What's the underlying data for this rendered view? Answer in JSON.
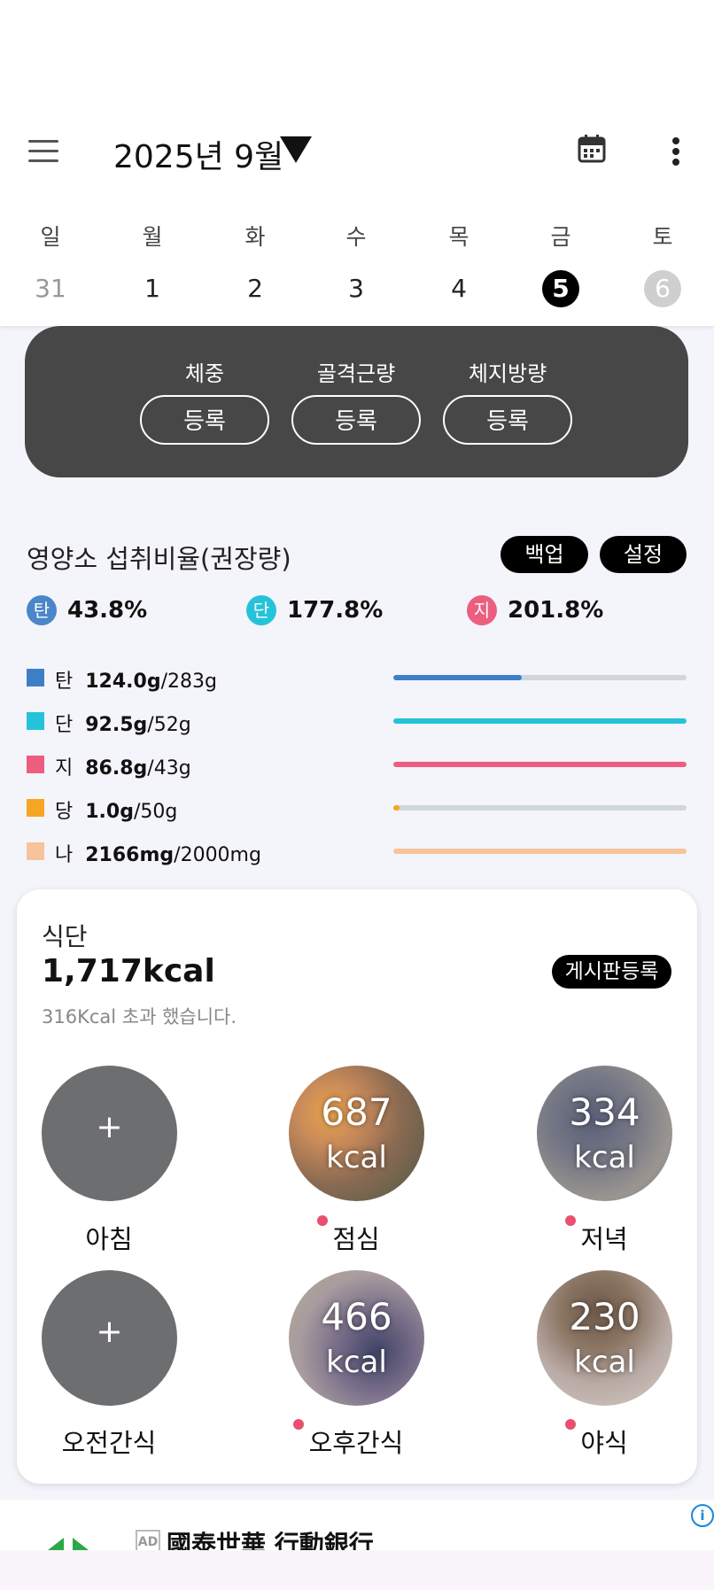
{
  "header": {
    "month_label": "2025년 9월",
    "icons": [
      "menu-icon",
      "dropdown-arrow-icon",
      "calendar-icon",
      "more-vert-icon"
    ]
  },
  "week": {
    "days": [
      "일",
      "월",
      "화",
      "수",
      "목",
      "금",
      "토"
    ],
    "dates": [
      "31",
      "1",
      "2",
      "3",
      "4",
      "5",
      "6"
    ],
    "selected_date": "5",
    "today_date": "6"
  },
  "body_card": {
    "items": [
      {
        "label": "체중",
        "button": "등록"
      },
      {
        "label": "골격근량",
        "button": "등록"
      },
      {
        "label": "체지방량",
        "button": "등록"
      }
    ]
  },
  "nutrition": {
    "title": "영양소 섭취비율(권장량)",
    "backup_label": "백업",
    "settings_label": "설정",
    "ratios": [
      {
        "icon": "탄",
        "value": "43.8%",
        "color": "#4a86c8"
      },
      {
        "icon": "단",
        "value": "177.8%",
        "color": "#25c3d9"
      },
      {
        "icon": "지",
        "value": "201.8%",
        "color": "#ec5e7f"
      }
    ],
    "rows": [
      {
        "name": "탄",
        "amount": "124.0g",
        "goal": "/283g",
        "color": "#3d7fc7",
        "progress": 0.438
      },
      {
        "name": "단",
        "amount": "92.5g",
        "goal": "/52g",
        "color": "#25c3d9",
        "progress": 1.0
      },
      {
        "name": "지",
        "amount": "86.8g",
        "goal": "/43g",
        "color": "#ec5e7f",
        "progress": 1.0
      },
      {
        "name": "당",
        "amount": "1.0g",
        "goal": "/50g",
        "color": "#f5a623",
        "progress": 0.02
      },
      {
        "name": "나",
        "amount": "2166mg",
        "goal": "/2000mg",
        "color": "#f6c49a",
        "progress": 1.0
      }
    ]
  },
  "meals": {
    "title": "식단",
    "total_kcal": "1,717kcal",
    "over_text": "316Kcal 초과 했습니다.",
    "board_button": "게시판등록",
    "plus": "+",
    "kcal_unit": "kcal",
    "items": [
      {
        "label": "아침",
        "value": "",
        "recorded": false
      },
      {
        "label": "점심",
        "value": "687",
        "recorded": true
      },
      {
        "label": "저녁",
        "value": "334",
        "recorded": true
      },
      {
        "label": "오전간식",
        "value": "",
        "recorded": false
      },
      {
        "label": "오후간식",
        "value": "466",
        "recorded": true
      },
      {
        "label": "야식",
        "value": "230",
        "recorded": true
      }
    ]
  },
  "ad": {
    "badge": "AD",
    "text": "國泰世華 行動銀行",
    "info": "i"
  }
}
